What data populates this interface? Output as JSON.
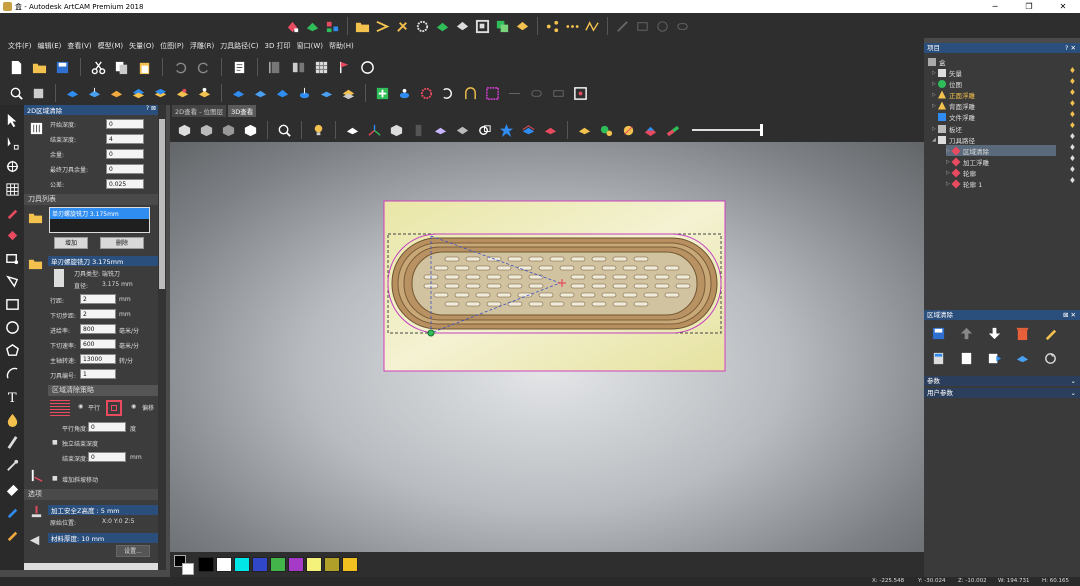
{
  "window": {
    "title": "盒 - Autodesk ArtCAM Premium 2018"
  },
  "menu": [
    "文件(F)",
    "编辑(E)",
    "查看(V)",
    "模型(M)",
    "矢量(O)",
    "位图(P)",
    "浮雕(R)",
    "刀具路径(C)",
    "3D 打印",
    "窗口(W)",
    "帮助(H)"
  ],
  "left_panel": {
    "title": "2D区域清除",
    "fields": [
      {
        "label": "开始深度:",
        "value": "0"
      },
      {
        "label": "结束深度:",
        "value": "4"
      },
      {
        "label": "余量:",
        "value": "0"
      },
      {
        "label": "最终刀具余量:",
        "value": "0"
      },
      {
        "label": "公差:",
        "value": "0.025"
      }
    ],
    "tool_list_title": "刀具列表",
    "tool_item": "单刃螺旋铣刀 3.175mm",
    "add_label": "增加",
    "delete_label": "删除",
    "tool_header": "单刃螺旋铣刀 3.175mm",
    "tool_type_label": "刀具类型: 端铣刀",
    "diameter_label": "直径:",
    "diameter_value": "3.175 mm",
    "params": [
      {
        "label": "行距:",
        "value": "2",
        "unit": "mm"
      },
      {
        "label": "下切步距:",
        "value": "2",
        "unit": "mm"
      },
      {
        "label": "进给率:",
        "value": "800",
        "unit": "毫米/分"
      },
      {
        "label": "下切速率:",
        "value": "600",
        "unit": "毫米/分"
      },
      {
        "label": "主轴转速:",
        "value": "13000",
        "unit": "转/分"
      },
      {
        "label": "刀具编号:",
        "value": "1",
        "unit": ""
      }
    ],
    "strategy_title": "区域清除策略",
    "opt_parallel": "平行",
    "opt_offset": "偏移",
    "angle_label": "平行角度:",
    "angle_value": "0",
    "angle_unit": "度",
    "independent_label": "独立结束深度",
    "end_depth_label": "结束深度:",
    "end_depth_value": "0",
    "end_depth_unit": "mm",
    "ramp_label": "增加斜坡移动",
    "options_title": "选项",
    "safe_z": "加工安全Z高度 : 5 mm",
    "home_label": "原始位置:",
    "home_value": "X:0 Y:0 Z:5",
    "material_label": "材料厚度: 10 mm",
    "settings_label": "设置..."
  },
  "view_tabs": [
    "2D查看 - 位图层",
    "3D查看"
  ],
  "colors": [
    "#000000",
    "#ffffff",
    "#00e5e5",
    "#2f47c8",
    "#42b44a",
    "#a63ac8",
    "#f4f27a",
    "#b0a02a",
    "#f0c020"
  ],
  "status": {
    "x": "X: -225.548",
    "y": "Y: -30.024",
    "z": "Z: -10.002",
    "w": "W: 194.731",
    "h": "H: 60.165"
  },
  "right_panel": {
    "title": "项目",
    "tree": [
      {
        "label": "盒",
        "level": 0
      },
      {
        "label": "矢量",
        "level": 1
      },
      {
        "label": "位图",
        "level": 1
      },
      {
        "label": "正面浮雕",
        "level": 1
      },
      {
        "label": "背面浮雕",
        "level": 1
      },
      {
        "label": "文件浮雕",
        "level": 1
      },
      {
        "label": "板坯",
        "level": 1
      },
      {
        "label": "刀具路径",
        "level": 1
      },
      {
        "label": "区域清除",
        "level": 2
      },
      {
        "label": "加工浮雕",
        "level": 2
      },
      {
        "label": "轮廓",
        "level": 2
      },
      {
        "label": "轮廓 1",
        "level": 2
      }
    ],
    "sub_title": "区域清除",
    "section_params": "参数",
    "section_user": "用户参数"
  }
}
